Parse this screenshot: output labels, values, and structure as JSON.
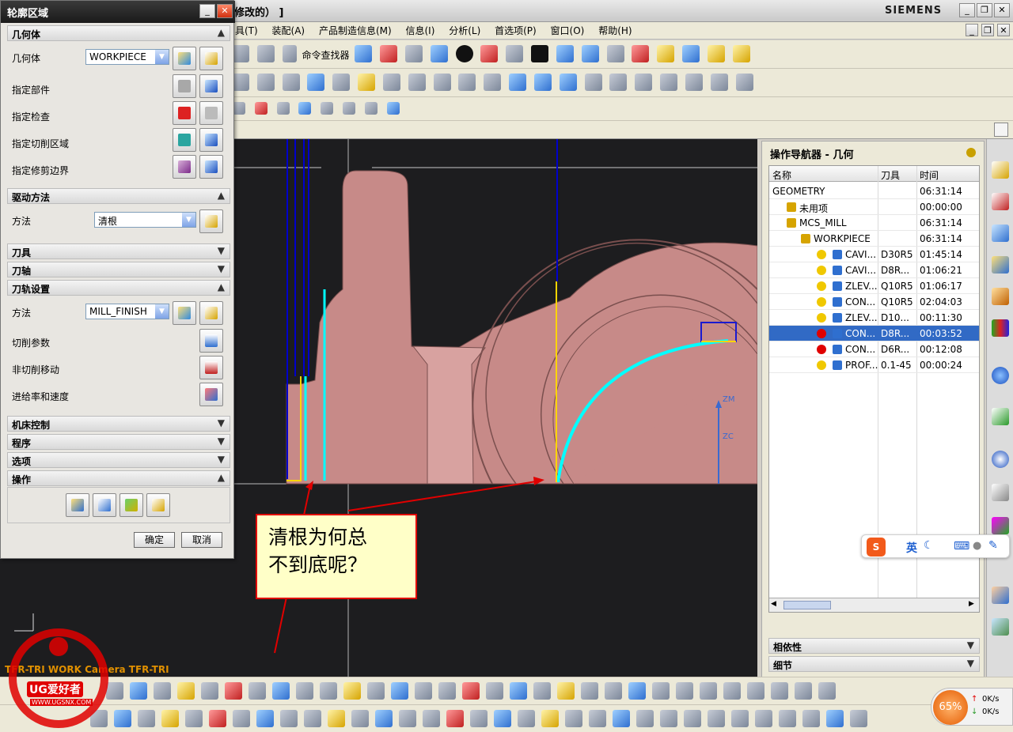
{
  "titlebar": {
    "text": "修改的） ]",
    "brand": "SIEMENS"
  },
  "menu": [
    "具(T)",
    "装配(A)",
    "产品制造信息(M)",
    "信息(I)",
    "分析(L)",
    "首选项(P)",
    "窗口(O)",
    "帮助(H)"
  ],
  "toolbar": {
    "command_finder": "命令查找器"
  },
  "dialog": {
    "title": "轮廓区域",
    "geometry": {
      "header": "几何体",
      "geometry_label": "几何体",
      "geometry_value": "WORKPIECE",
      "part_label": "指定部件",
      "check_label": "指定检查",
      "cut_area_label": "指定切削区域",
      "trim_label": "指定修剪边界"
    },
    "drive": {
      "header": "驱动方法",
      "method_label": "方法",
      "method_value": "清根"
    },
    "tool": {
      "header": "刀具"
    },
    "axis": {
      "header": "刀轴"
    },
    "path": {
      "header": "刀轨设置",
      "method_label": "方法",
      "method_value": "MILL_FINISH",
      "cut_params": "切削参数",
      "non_cut": "非切削移动",
      "feeds": "进给率和速度"
    },
    "machine": {
      "header": "机床控制"
    },
    "program": {
      "header": "程序"
    },
    "options": {
      "header": "选项"
    },
    "actions": {
      "header": "操作"
    },
    "ok": "确定",
    "cancel": "取消"
  },
  "viewport": {
    "camera_label": "TFR-TRI WORK Camera TFR-TRI",
    "axis_zm": "ZM",
    "axis_zc": "ZC",
    "note_line1": "清根为何总",
    "note_line2": "不到底呢？"
  },
  "navigator": {
    "title": "操作导航器 - 几何",
    "columns": [
      "名称",
      "刀具",
      "时间"
    ],
    "rows": [
      {
        "name": "GEOMETRY",
        "tool": "",
        "time": "06:31:14",
        "indent": 0
      },
      {
        "name": "未用项",
        "tool": "",
        "time": "00:00:00",
        "indent": 1
      },
      {
        "name": "MCS_MILL",
        "tool": "",
        "time": "06:31:14",
        "indent": 1
      },
      {
        "name": "WORKPIECE",
        "tool": "",
        "time": "06:31:14",
        "indent": 2
      },
      {
        "name": "CAVI...",
        "tool": "D30R5",
        "time": "01:45:14",
        "indent": 3
      },
      {
        "name": "CAVI...",
        "tool": "D8R...",
        "time": "01:06:21",
        "indent": 3
      },
      {
        "name": "ZLEV...",
        "tool": "Q10R5",
        "time": "01:06:17",
        "indent": 3
      },
      {
        "name": "CON...",
        "tool": "Q10R5",
        "time": "02:04:03",
        "indent": 3
      },
      {
        "name": "ZLEV...",
        "tool": "D10...",
        "time": "00:11:30",
        "indent": 3
      },
      {
        "name": "CON...",
        "tool": "D8R...",
        "time": "00:03:52",
        "indent": 3,
        "selected": true
      },
      {
        "name": "CON...",
        "tool": "D6R...",
        "time": "00:12:08",
        "indent": 3
      },
      {
        "name": "PROF...",
        "tool": "0.1-45",
        "time": "00:00:24",
        "indent": 3
      }
    ],
    "dependency": "相依性",
    "details": "细节"
  },
  "ime": {
    "lang": "英"
  },
  "network": {
    "percent": "65%",
    "up": "0K/s",
    "down": "0K/s"
  },
  "watermark": {
    "brand": "UG爱好者",
    "url": "WWW.UGSNX.COM"
  },
  "colors": {
    "cyan": "#00ffff",
    "selection": "#316ac5",
    "part": "#c98a86"
  }
}
